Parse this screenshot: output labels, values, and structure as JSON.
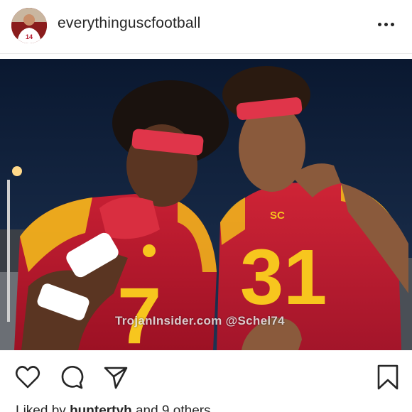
{
  "post": {
    "username": "everythinguscfootball",
    "avatar_icon": "profile-avatar",
    "more_icon": "more-options-icon"
  },
  "photo": {
    "watermark": "TrojanInsider.com @Schel74",
    "left_jersey_number": "7",
    "right_jersey_number": "31",
    "chest_logo": "SC",
    "jersey_color": "#b5172e",
    "number_color": "#f7c61e"
  },
  "actions": {
    "like_icon": "heart-icon",
    "comment_icon": "comment-icon",
    "share_icon": "share-icon",
    "save_icon": "bookmark-icon"
  },
  "likes": {
    "prefix": "Liked by",
    "user": "huntertyh",
    "suffix": "and 9 others"
  }
}
